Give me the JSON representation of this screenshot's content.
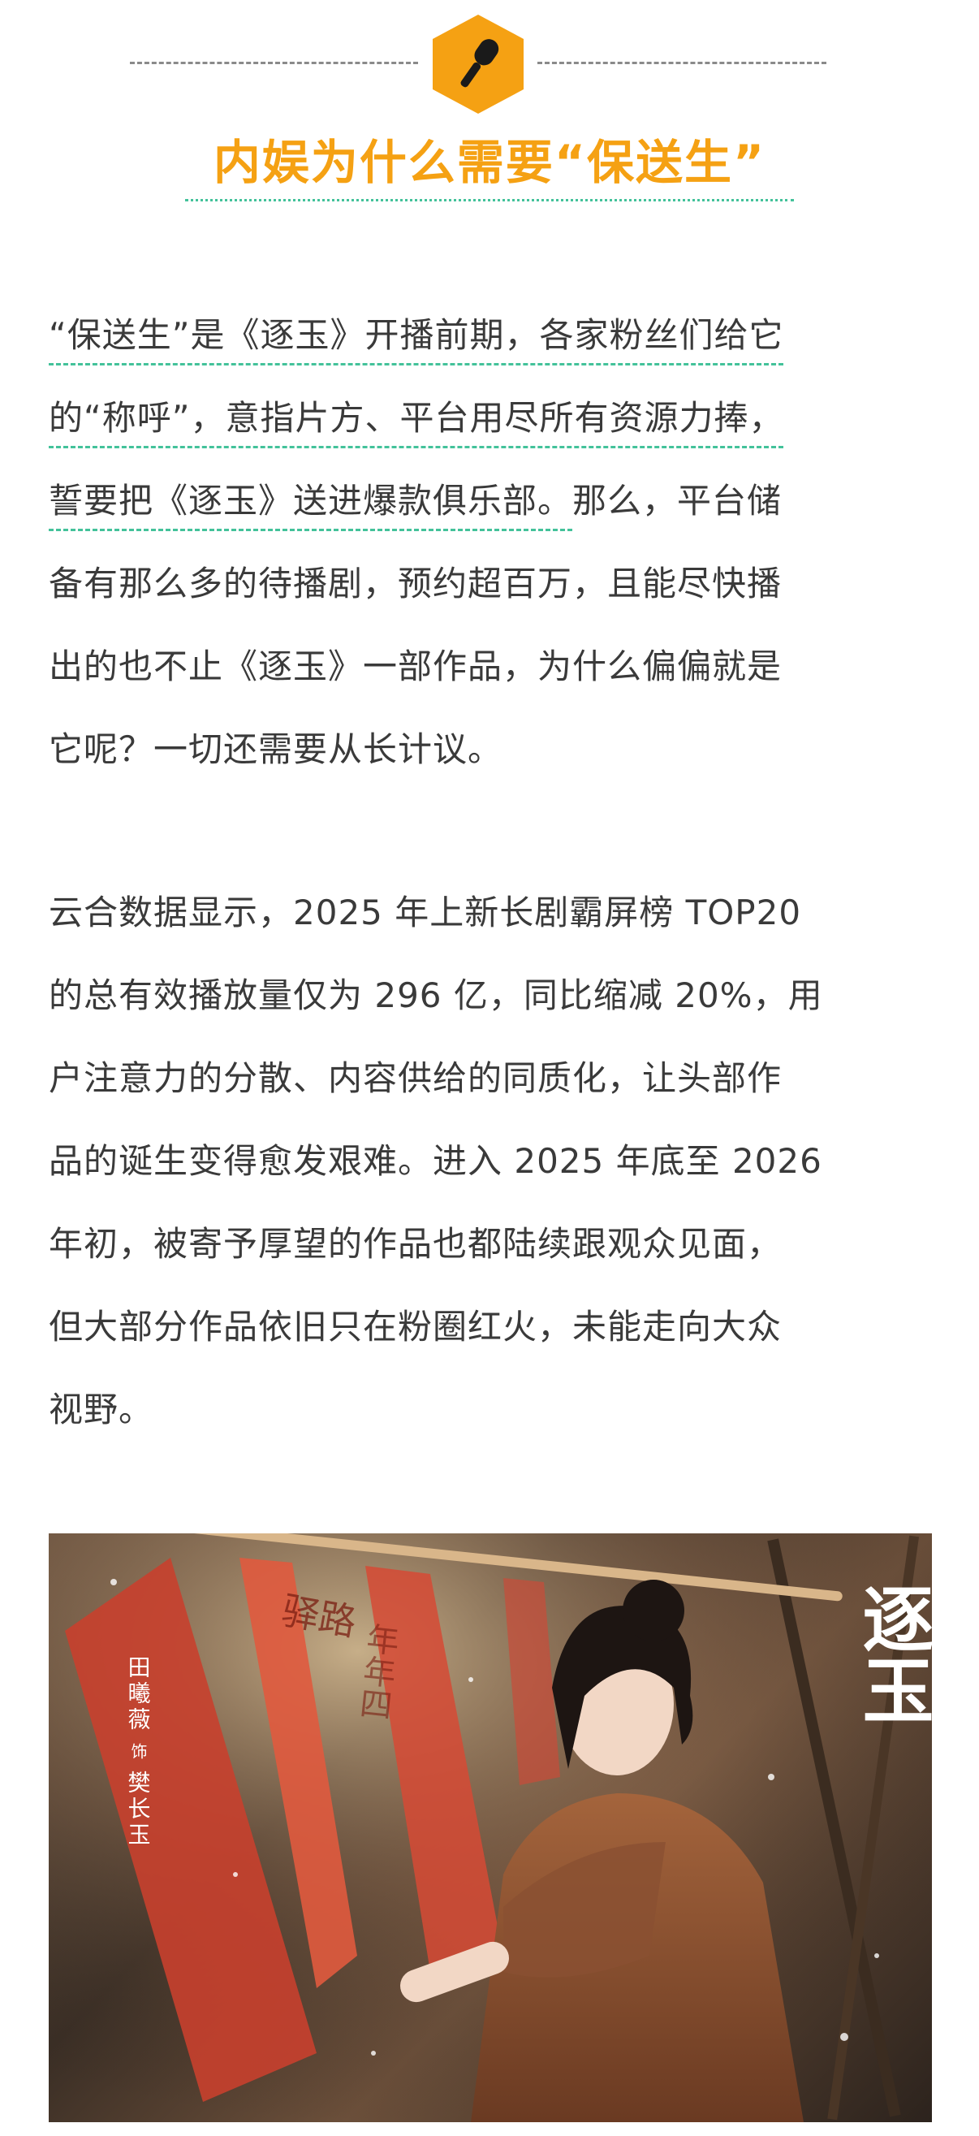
{
  "header": {
    "title": "内娱为什么需要“保送生”",
    "badge_icon": "microphone-icon",
    "accent_color": "#f5a113",
    "underline_color": "#43c29a"
  },
  "paragraph_1": {
    "lines": [
      "“保送生”是《逐玉》开播前期，各家粉丝们给它",
      "的“称呼”，意指片方、平台用尽所有资源力捧，",
      "誓要把《逐玉》送进爆款俱乐部。",
      "那么，平台储",
      "备有那么多的待播剧，预约超百万，且能尽快播",
      "出的也不止《逐玉》一部作品，为什么偏偏就是",
      "它呢？一切还需要从长计议。"
    ]
  },
  "paragraph_2": {
    "lines": [
      "云合数据显示，2025 年上新长剧霸屏榜 TOP20",
      "的总有效播放量仅为 296 亿，同比缩减 20%，用",
      "户注意力的分散、内容供给的同质化，让头部作",
      "品的诞生变得愈发艰难。进入 2025 年底至 2026",
      "年初，被寄予厚望的作品也都陆续跟观众见面，",
      "但大部分作品依旧只在粉圈红火，未能走向大众",
      "视野。"
    ]
  },
  "photo": {
    "logo_text": "逐玉",
    "actor_name": "田曦薇",
    "role_connector": "饰",
    "role_name": "樊长玉",
    "banner_left": "驿路",
    "banner_mid": "年年四"
  }
}
